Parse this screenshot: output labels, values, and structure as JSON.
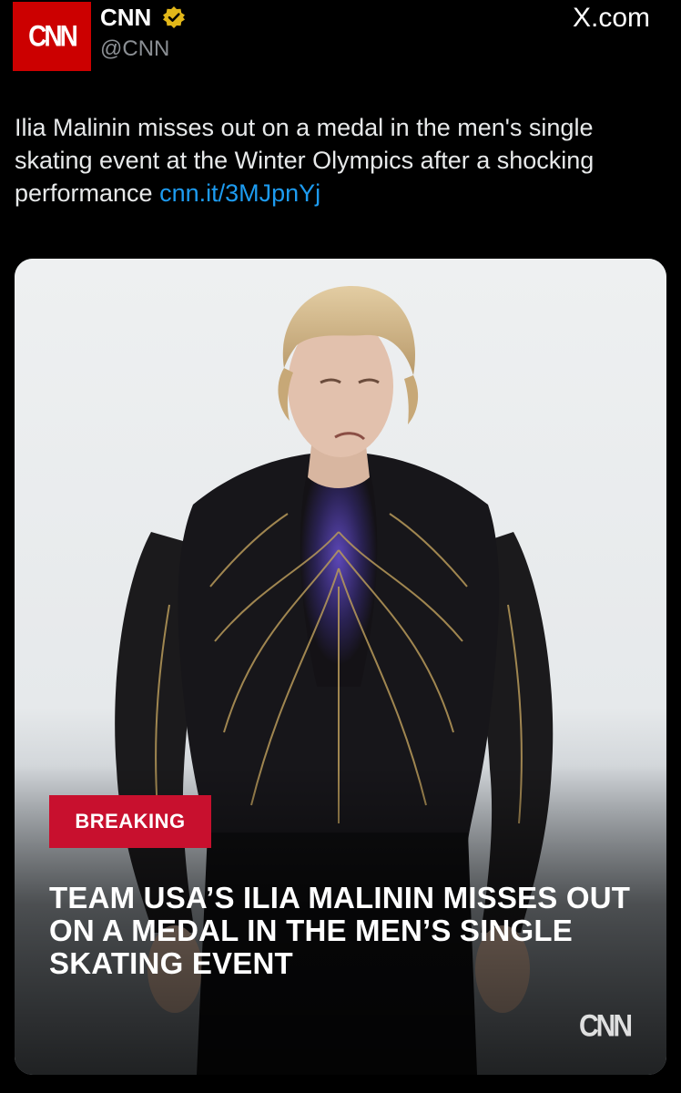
{
  "author": {
    "avatar_text": "CNN",
    "display_name": "CNN",
    "handle": "@CNN",
    "verified_icon": "verified-badge-icon",
    "avatar_color": "#cc0000",
    "badge_color": "#e2b719"
  },
  "source": {
    "label": "X.com"
  },
  "tweet": {
    "text": "Ilia Malinin misses out on a medal in the men's single skating event at the Winter Olympics after a shocking performance ",
    "link_text": "cnn.it/3MJpnYj",
    "link_color": "#1d9bf0"
  },
  "media": {
    "badge": "BREAKING",
    "badge_color": "#c8102e",
    "headline": "TEAM USA’S ILIA MALININ MISSES OUT ON A MEDAL IN THE MEN’S SINGLE SKATING EVENT",
    "watermark": "CNN"
  }
}
